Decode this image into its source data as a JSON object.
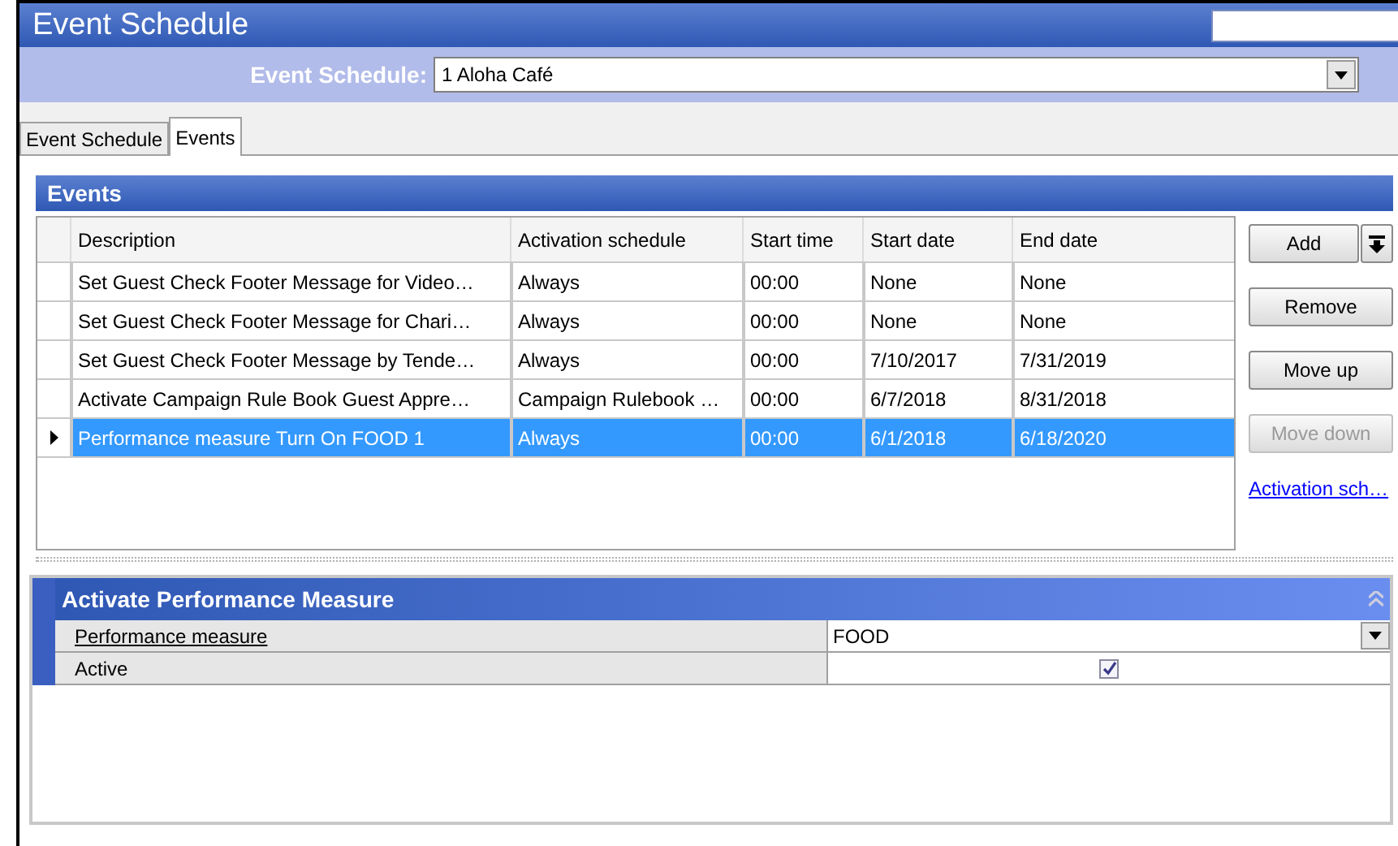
{
  "window": {
    "title": "Event Schedule"
  },
  "schedule_picker": {
    "label": "Event Schedule:",
    "value": "1 Aloha Café"
  },
  "tabs": [
    {
      "label": "Event Schedule",
      "selected": false
    },
    {
      "label": "Events",
      "selected": true
    }
  ],
  "events_panel": {
    "title": "Events",
    "columns": [
      "Description",
      "Activation schedule",
      "Start time",
      "Start date",
      "End date"
    ],
    "rows": [
      {
        "cells": [
          "Set Guest Check Footer Message for Video…",
          "Always",
          "00:00",
          "None",
          "None"
        ],
        "selected": false
      },
      {
        "cells": [
          "Set Guest Check Footer Message for Chari…",
          "Always",
          "00:00",
          "None",
          "None"
        ],
        "selected": false
      },
      {
        "cells": [
          "Set Guest Check Footer Message by Tende…",
          "Always",
          "00:00",
          "7/10/2017",
          "7/31/2019"
        ],
        "selected": false
      },
      {
        "cells": [
          "Activate Campaign Rule Book Guest Appre…",
          "Campaign Rulebook …",
          "00:00",
          "6/7/2018",
          "8/31/2018"
        ],
        "selected": false
      },
      {
        "cells": [
          "Performance measure Turn On FOOD 1",
          "Always",
          "00:00",
          "6/1/2018",
          "6/18/2020"
        ],
        "selected": true
      }
    ],
    "buttons": [
      {
        "kind": "split",
        "label": "Add",
        "disabled": false
      },
      {
        "kind": "plain",
        "label": "Remove",
        "disabled": false
      },
      {
        "kind": "plain",
        "label": "Move up",
        "disabled": false
      },
      {
        "kind": "plain",
        "label": "Move down",
        "disabled": true
      }
    ],
    "link": "Activation sch…"
  },
  "properties_panel": {
    "title": "Activate Performance Measure",
    "rows": [
      {
        "kind": "dropdown",
        "label": "Performance measure",
        "value": "FOOD"
      },
      {
        "kind": "checkbox",
        "label": "Active",
        "checked": true
      }
    ]
  }
}
